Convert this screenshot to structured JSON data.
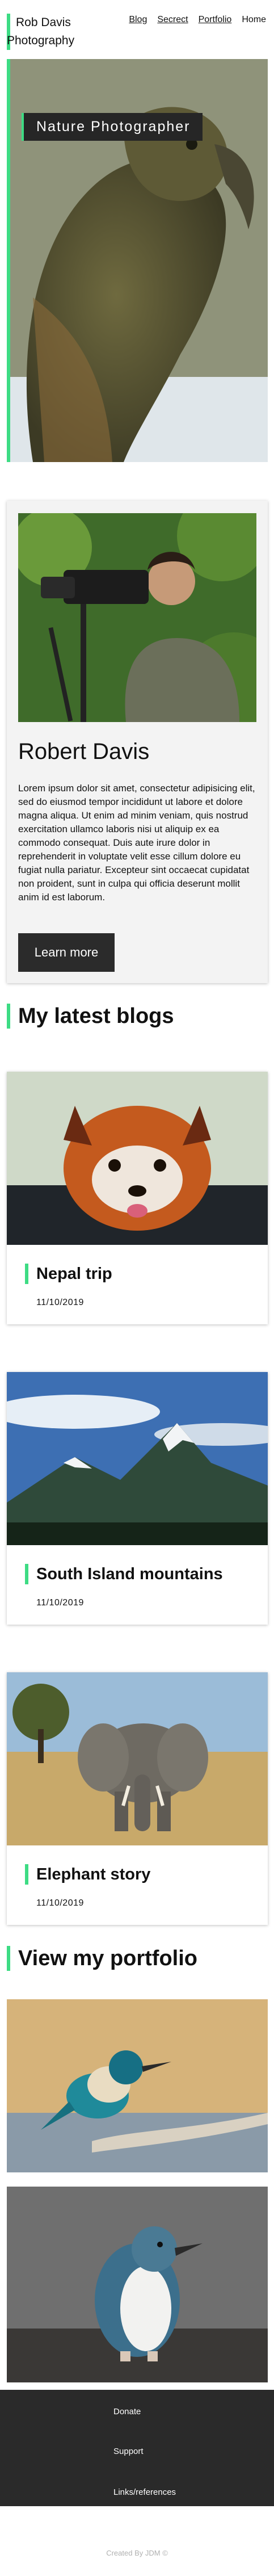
{
  "header": {
    "brand_line1": "Rob Davis",
    "brand_line2": "Photography",
    "nav": [
      {
        "label": "Blog"
      },
      {
        "label": "Secrect"
      },
      {
        "label": "Portfolio"
      },
      {
        "label": "Home"
      }
    ]
  },
  "hero": {
    "tagline": "Nature Photographer"
  },
  "about": {
    "name": "Robert Davis",
    "text": "Lorem ipsum dolor sit amet, consectetur adipisicing elit, sed do eiusmod tempor incididunt ut labore et dolore magna aliqua. Ut enim ad minim veniam, quis nostrud exercitation ullamco laboris nisi ut aliquip ex ea commodo consequat. Duis aute irure dolor in reprehenderit in voluptate velit esse cillum dolore eu fugiat nulla pariatur. Excepteur sint occaecat cupidatat non proident, sunt in culpa qui officia deserunt mollit anim id est laborum.",
    "button": "Learn more"
  },
  "blogs": {
    "heading": "My latest blogs",
    "items": [
      {
        "title": "Nepal trip",
        "date": "11/10/2019",
        "image": "red-panda"
      },
      {
        "title": "South Island mountains",
        "date": "11/10/2019",
        "image": "mountains"
      },
      {
        "title": "Elephant story",
        "date": "11/10/2019",
        "image": "elephant"
      }
    ]
  },
  "portfolio": {
    "heading": "View my portfolio",
    "items": [
      {
        "image": "kingfisher"
      },
      {
        "image": "penguin"
      }
    ]
  },
  "footer": {
    "links": [
      {
        "label": "Donate"
      },
      {
        "label": "Support"
      },
      {
        "label": "Links/references"
      }
    ],
    "credit": "Created By JDM ©"
  },
  "colors": {
    "accent": "#3ddc84",
    "dark": "#2a2a2a",
    "card": "#f3f3f3"
  }
}
